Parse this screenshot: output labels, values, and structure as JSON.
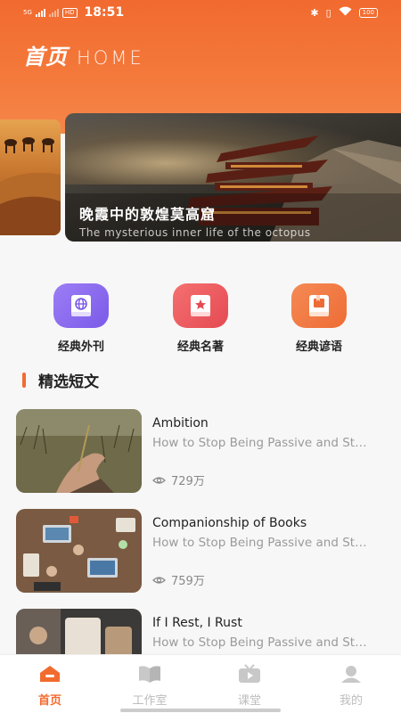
{
  "status_bar": {
    "signal": "5G",
    "hd": "HD",
    "time": "18:51",
    "battery": "100"
  },
  "header": {
    "title_cn": "首页",
    "title_en": "HOME"
  },
  "banner": {
    "title": "晚霞中的敦煌莫高窟",
    "subtitle": "The mysterious inner life of the octopus"
  },
  "categories": [
    {
      "label": "经典外刊",
      "icon": "globe-book-icon",
      "color": "#8a6cf0"
    },
    {
      "label": "经典名著",
      "icon": "star-book-icon",
      "color": "#ef5b5b"
    },
    {
      "label": "经典谚语",
      "icon": "bookmark-book-icon",
      "color": "#f07a44"
    }
  ],
  "section": {
    "title": "精选短文"
  },
  "articles": [
    {
      "title": "Ambition",
      "desc": "How to Stop Being Passive and Start Living Your Life",
      "views": "729万"
    },
    {
      "title": "Companionship of Books",
      "desc": "How to Stop Being Passive and Start Living Your Life",
      "views": "759万"
    },
    {
      "title": "If I Rest, I Rust",
      "desc": "How to Stop Being Passive and Start Living Your Life",
      "views": ""
    }
  ],
  "tabs": [
    {
      "label": "首页",
      "icon": "home-icon",
      "active": true
    },
    {
      "label": "工作室",
      "icon": "open-book-icon",
      "active": false
    },
    {
      "label": "课堂",
      "icon": "tv-play-icon",
      "active": false
    },
    {
      "label": "我的",
      "icon": "user-icon",
      "active": false
    }
  ],
  "colors": {
    "accent": "#f26b2e",
    "inactive": "#bdbdbd"
  }
}
